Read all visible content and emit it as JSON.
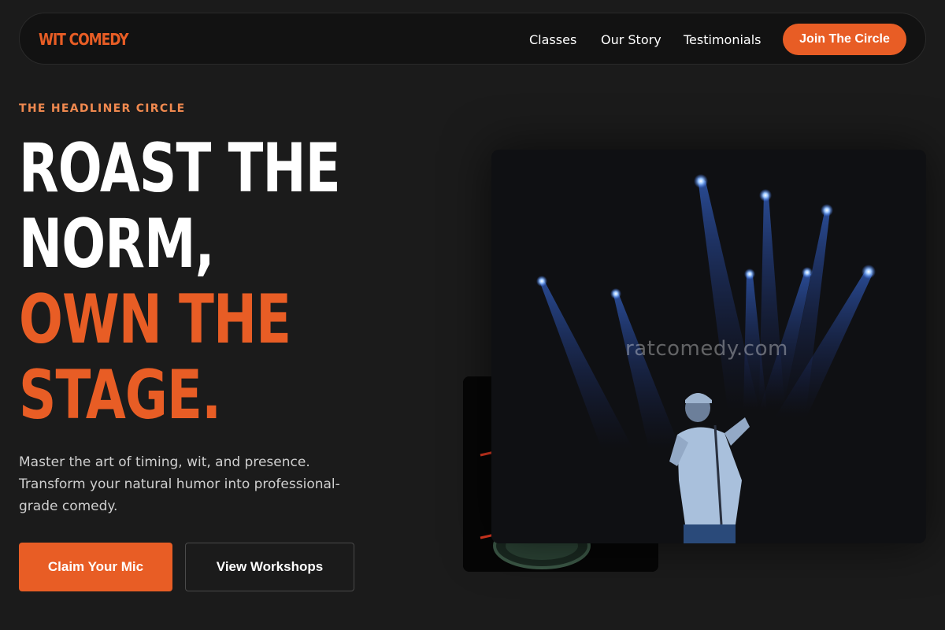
{
  "nav": {
    "logo": "WIT COMEDY",
    "links": [
      "Classes",
      "Our Story",
      "Testimonials"
    ],
    "cta": "Join The Circle"
  },
  "hero": {
    "eyebrow": "THE HEADLINER CIRCLE",
    "headline_white": [
      "ROAST THE",
      "NORM,"
    ],
    "headline_orange": [
      "OWN THE",
      "STAGE."
    ],
    "description": "Master the art of timing, wit, and presence. Transform your natural humor into professional-grade comedy.",
    "primary_button": "Claim Your Mic",
    "secondary_button": "View Workshops"
  },
  "images": {
    "main_alt": "Comedian performing on stage under blue spotlights",
    "back_alt": "Neon comedy club sign",
    "watermark": "ratcomedy.com"
  },
  "colors": {
    "accent": "#e85d25",
    "eyebrow": "#f0894f",
    "background": "#1b1b1b",
    "nav_background": "#121212"
  }
}
